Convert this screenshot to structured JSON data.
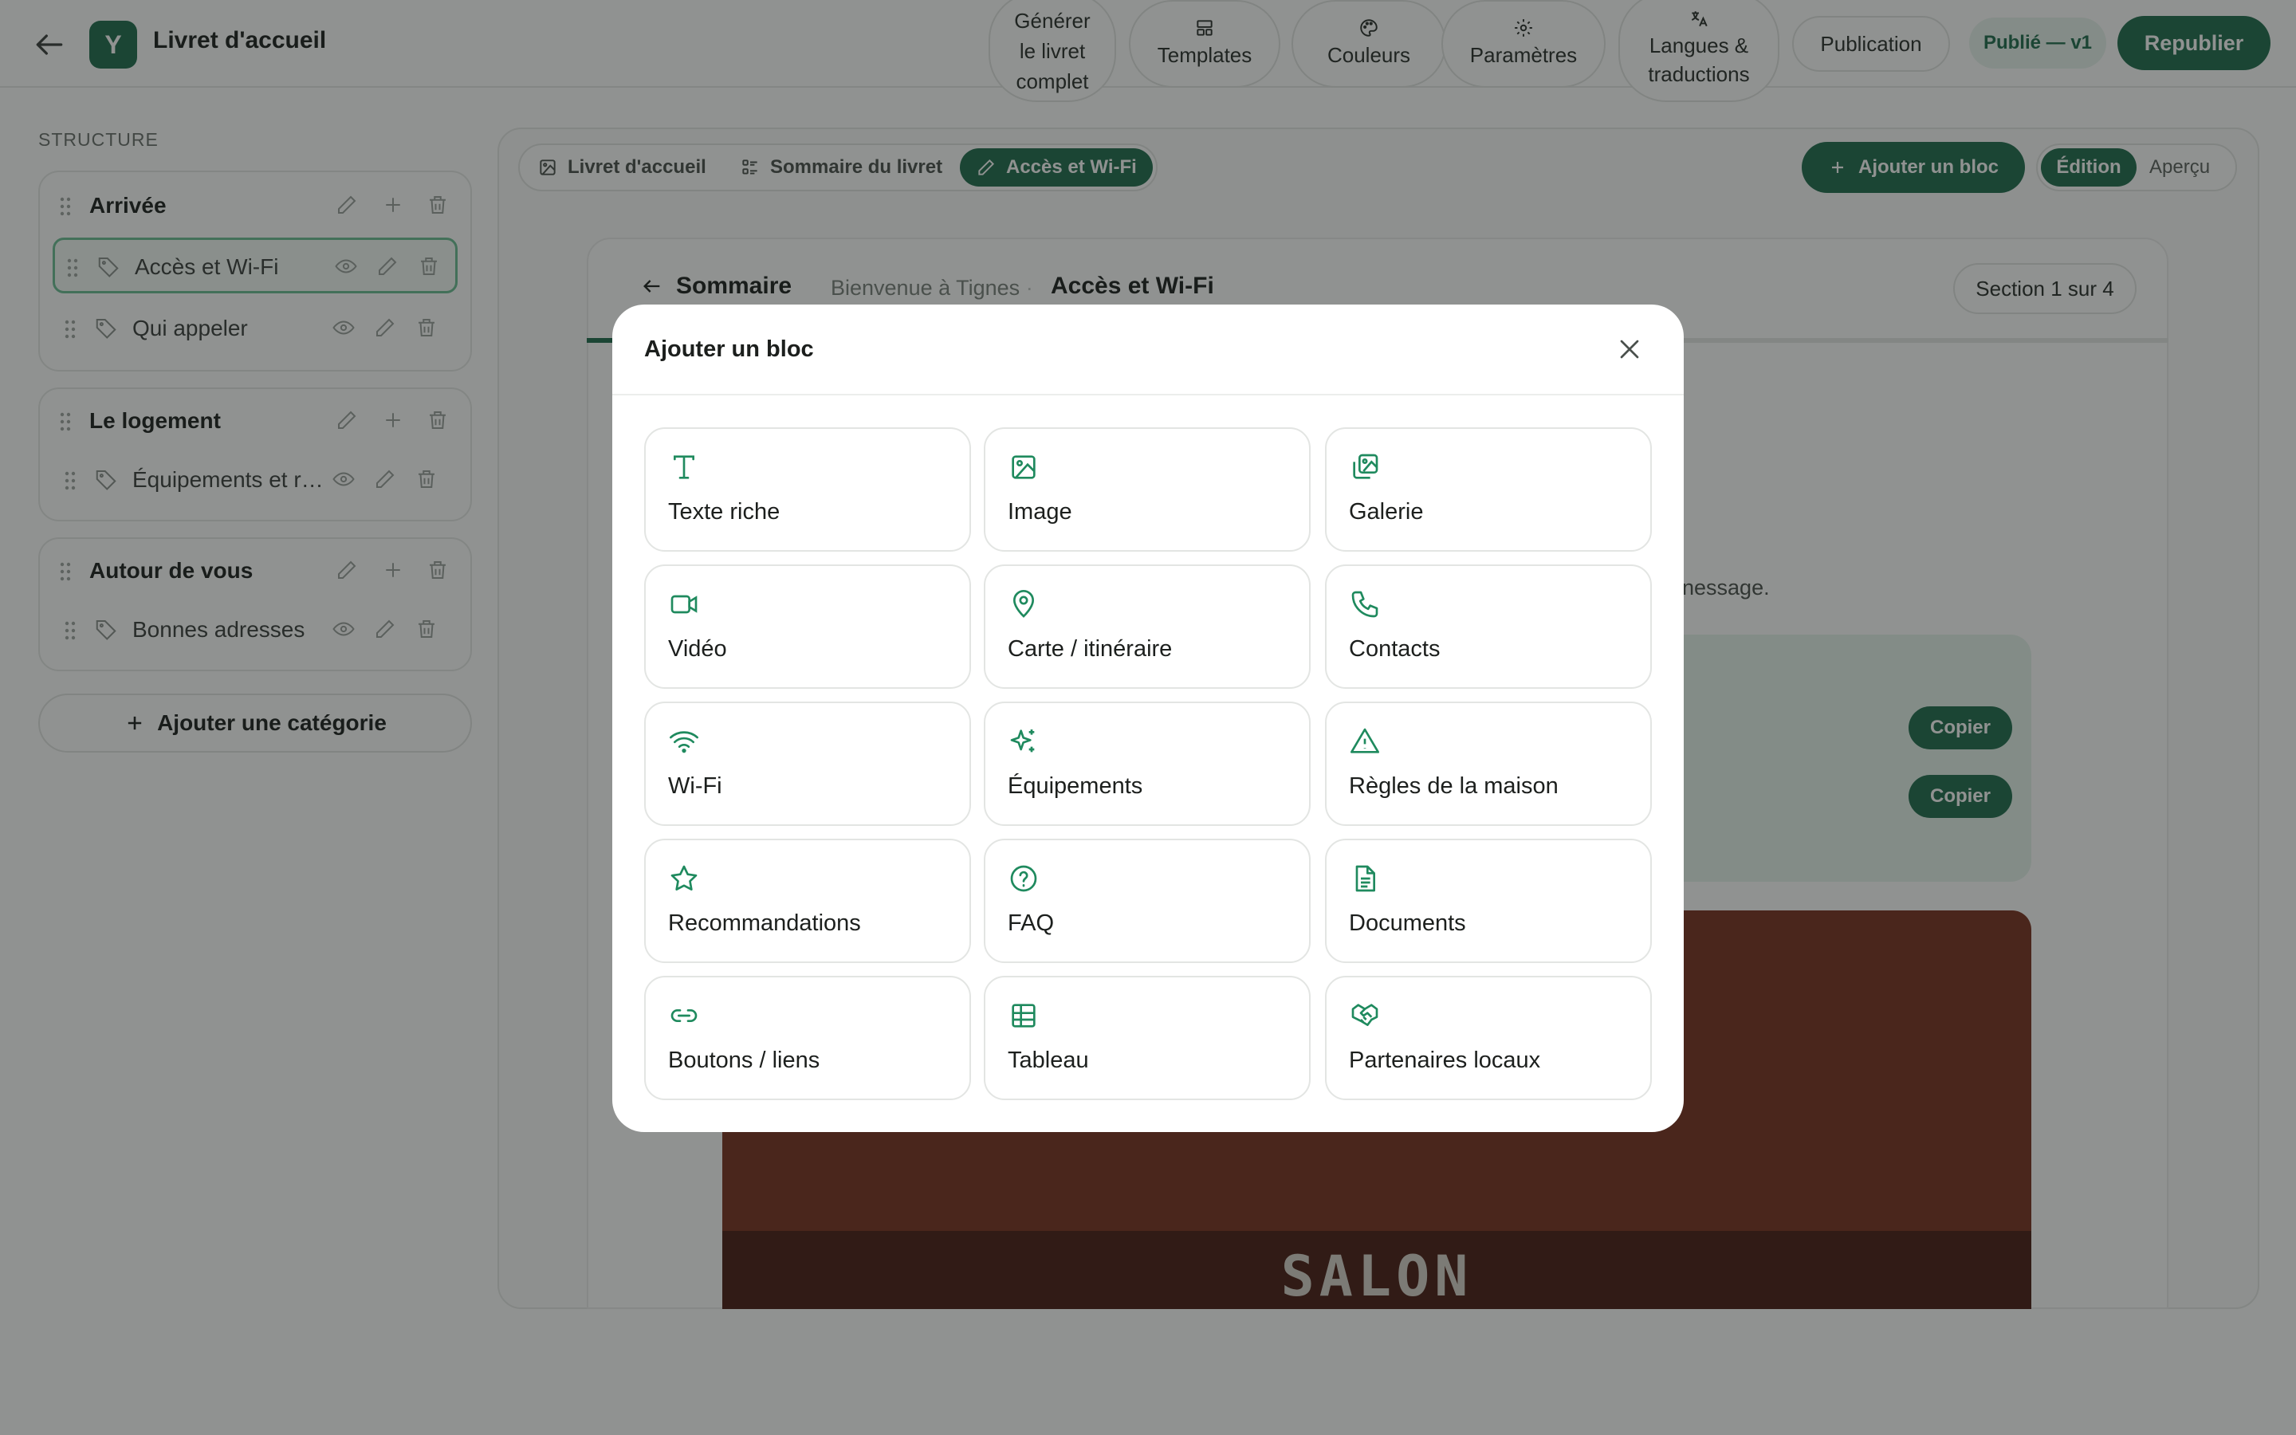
{
  "header": {
    "title": "Livret d'accueil",
    "logo_letter": "Y",
    "nav": [
      {
        "label": "Générer le livret complet",
        "icon": "wand-icon"
      },
      {
        "label": "Templates",
        "icon": "layout-icon"
      },
      {
        "label": "Couleurs",
        "icon": "palette-icon"
      },
      {
        "label": "Paramètres",
        "icon": "gear-icon"
      },
      {
        "label": "Langues & traductions",
        "icon": "translate-icon"
      },
      {
        "label": "Publication"
      }
    ],
    "status": "Publié — v1",
    "republish": "Republier"
  },
  "sidebar": {
    "heading": "STRUCTURE",
    "categories": [
      {
        "title": "Arrivée",
        "items": [
          {
            "label": "Accès et Wi-Fi",
            "active": true
          },
          {
            "label": "Qui appeler"
          }
        ]
      },
      {
        "title": "Le logement",
        "items": [
          {
            "label": "Équipements et r…"
          }
        ]
      },
      {
        "title": "Autour de vous",
        "items": [
          {
            "label": "Bonnes adresses"
          }
        ]
      }
    ],
    "add_category": "Ajouter une catégorie"
  },
  "tabs": [
    {
      "label": "Livret d'accueil",
      "icon": "image-icon"
    },
    {
      "label": "Sommaire du livret",
      "icon": "list-icon"
    },
    {
      "label": "Accès et Wi-Fi",
      "icon": "pencil-icon",
      "active": true
    }
  ],
  "toolbar": {
    "add_block": "Ajouter un bloc",
    "mode_edit": "Édition",
    "mode_preview": "Aperçu"
  },
  "preview": {
    "back": "Sommaire",
    "crumb_parent": "Bienvenue à Tignes",
    "crumb_current": "Accès et Wi-Fi",
    "section": "Section 1 sur 4",
    "progress": 0.25,
    "partial_text": "nessage.",
    "copy_label": "Copier",
    "photo_sign": "SALON"
  },
  "modal": {
    "title": "Ajouter un bloc",
    "blocks": [
      {
        "label": "Texte riche",
        "icon": "text-icon"
      },
      {
        "label": "Image",
        "icon": "image-icon"
      },
      {
        "label": "Galerie",
        "icon": "gallery-icon"
      },
      {
        "label": "Vidéo",
        "icon": "video-icon"
      },
      {
        "label": "Carte / itinéraire",
        "icon": "map-pin-icon"
      },
      {
        "label": "Contacts",
        "icon": "phone-icon"
      },
      {
        "label": "Wi-Fi",
        "icon": "wifi-icon"
      },
      {
        "label": "Équipements",
        "icon": "sparkles-icon"
      },
      {
        "label": "Règles de la maison",
        "icon": "warning-icon"
      },
      {
        "label": "Recommandations",
        "icon": "star-icon"
      },
      {
        "label": "FAQ",
        "icon": "help-circle-icon"
      },
      {
        "label": "Documents",
        "icon": "document-icon"
      },
      {
        "label": "Boutons / liens",
        "icon": "link-icon"
      },
      {
        "label": "Tableau",
        "icon": "table-icon"
      },
      {
        "label": "Partenaires locaux",
        "icon": "handshake-icon"
      }
    ]
  },
  "colors": {
    "accent": "#1f6b4d",
    "accent_soft": "#e7f4ec",
    "overlay": "rgba(24,28,26,0.48)"
  }
}
